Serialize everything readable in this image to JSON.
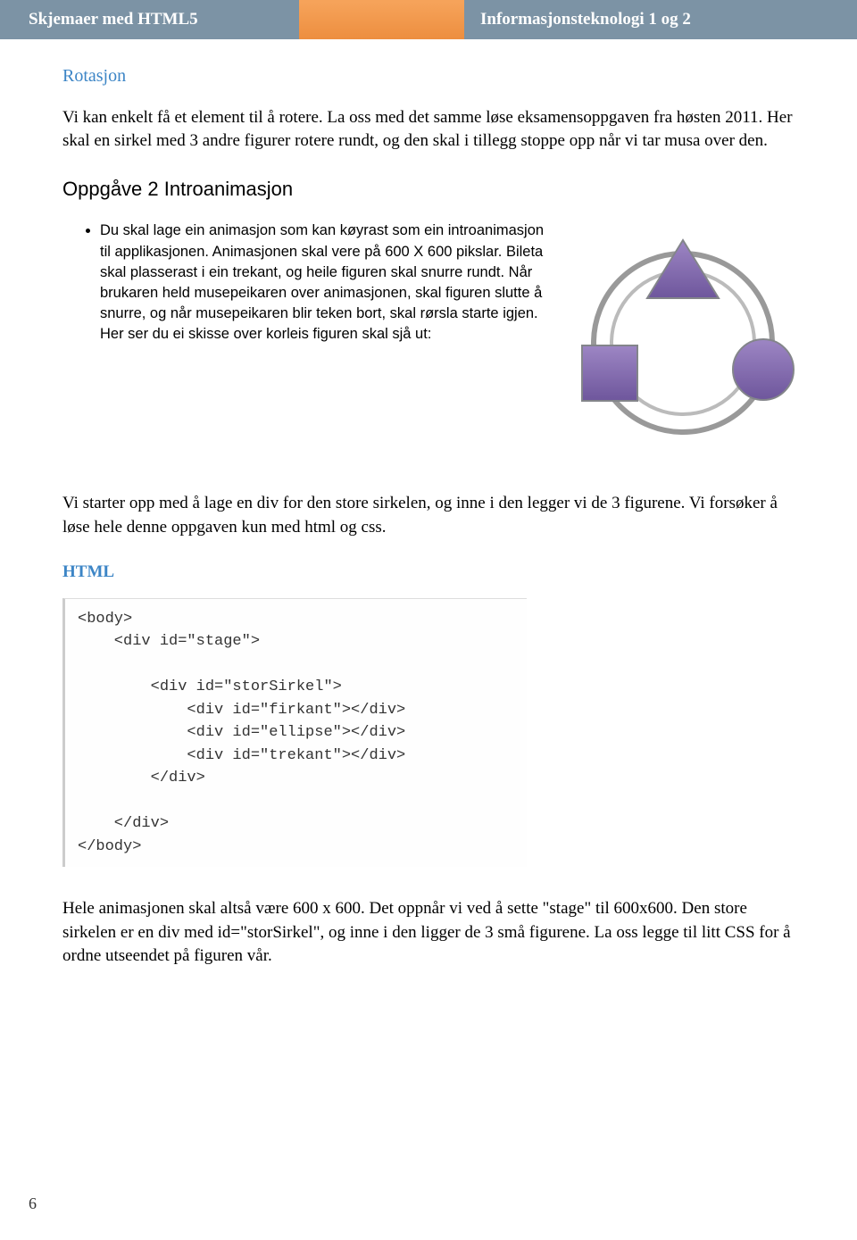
{
  "header": {
    "left": "Skjemaer med HTML5",
    "right": "Informasjonsteknologi 1 og 2"
  },
  "sections": {
    "rotation_title": "Rotasjon",
    "intro": "Vi kan enkelt få et element til å rotere. La oss med det samme løse eksamensoppgaven fra høsten 2011. Her skal en sirkel med 3 andre figurer rotere rundt, og den skal i tillegg stoppe opp når vi tar musa over den.",
    "exercise_title": "Oppgåve 2 Introanimasjon",
    "exercise_bullet": "Du skal lage ein animasjon som kan køyrast som ein introanimasjon til applikasjonen. Animasjonen skal vere på 600 X 600 pikslar. Bileta skal plasserast i ein trekant, og heile figuren skal snurre rundt. Når brukaren held musepeikaren over animasjonen, skal figuren slutte å snurre, og når musepeikaren blir teken bort, skal rørsla starte igjen. Her ser du ei skisse over korleis figuren skal sjå ut:",
    "after_diagram": "Vi starter opp med å lage en div for den store sirkelen, og inne i den legger vi de 3 figurene. Vi forsøker å løse hele denne oppgaven kun med html og css.",
    "html_label": "HTML",
    "code": "<body>\n    <div id=\"stage\">\n\n        <div id=\"storSirkel\">\n            <div id=\"firkant\"></div>\n            <div id=\"ellipse\"></div>\n            <div id=\"trekant\"></div>\n        </div>\n\n    </div>\n</body>",
    "closing": "Hele animasjonen skal altså være 600 x 600. Det oppnår vi ved å sette \"stage\" til 600x600. Den store sirkelen er en div med id=\"storSirkel\", og inne i den ligger de 3 små figurene. La oss legge til litt CSS for å ordne utseendet på figuren vår."
  },
  "page_number": "6"
}
